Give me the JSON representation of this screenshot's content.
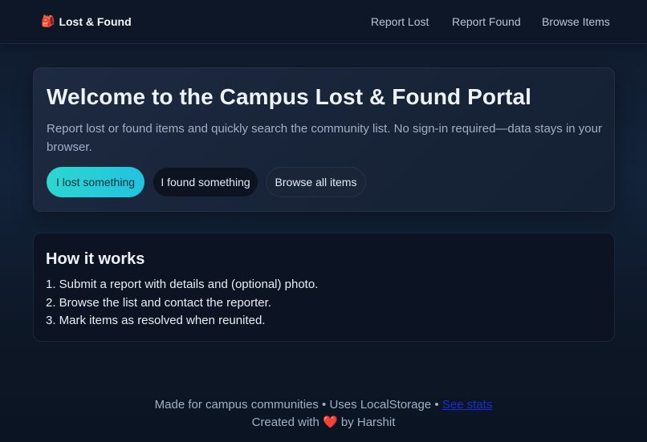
{
  "header": {
    "brand_emoji": "🎒",
    "brand": "Lost & Found",
    "nav": [
      "Report Lost",
      "Report Found",
      "Browse Items"
    ]
  },
  "hero": {
    "title": "Welcome to the Campus Lost & Found Portal",
    "subtitle": "Report lost or found items and quickly search the community list. No sign-in required—data stays in your browser.",
    "buttons": {
      "lost": "I lost something",
      "found": "I found something",
      "browse": "Browse all items"
    }
  },
  "how": {
    "title": "How it works",
    "steps": [
      "1. Submit a report with details and (optional) photo.",
      "2. Browse the list and contact the reporter.",
      "3. Mark items as resolved when reunited."
    ]
  },
  "footer": {
    "line1_prefix": "Made for campus communities • Uses LocalStorage •",
    "line1_link": "See stats",
    "line2_prefix": "Created with",
    "heart": "❤️",
    "line2_suffix": "by Harshit"
  },
  "colors": {
    "accent": "#2dd6d0",
    "background": "#13233a",
    "card": "#1d2a40"
  }
}
